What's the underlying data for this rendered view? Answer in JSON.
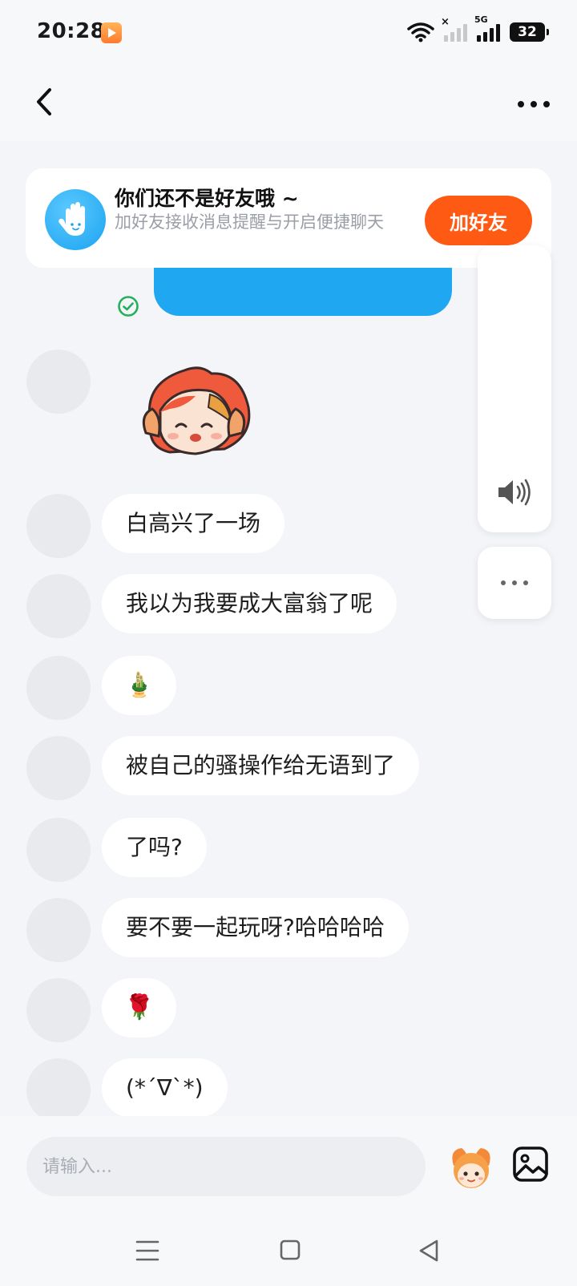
{
  "status_bar": {
    "time": "20:28",
    "network_label": "5G",
    "battery_level": "32",
    "icons": [
      "app-badge-icon",
      "wifi-icon",
      "signal-no-sim-icon",
      "signal-5g-icon",
      "battery-icon"
    ]
  },
  "header": {
    "back_icon": "chevron-left-icon",
    "more_icon": "more-horizontal-icon"
  },
  "friend_banner": {
    "icon": "waving-hand-icon",
    "title": "你们还不是好友哦 ~",
    "subtitle": "加好友接收消息提醒与开启便捷聊天",
    "button_label": "加好友",
    "button_color": "#ff5a14"
  },
  "messages": [
    {
      "type": "sticker",
      "content": "cartoon-character-sticker"
    },
    {
      "type": "text",
      "content": "白高兴了一场"
    },
    {
      "type": "text",
      "content": "我以为我要成大富翁了呢"
    },
    {
      "type": "emoji",
      "content": "🎍"
    },
    {
      "type": "text",
      "content": "被自己的骚操作给无语到了"
    },
    {
      "type": "text",
      "content": "了吗?"
    },
    {
      "type": "text",
      "content": "要不要一起玩呀?哈哈哈哈"
    },
    {
      "type": "emoji",
      "content": "🌹"
    },
    {
      "type": "text",
      "content": "(*´∇`*)"
    }
  ],
  "floating_panel": {
    "volume_icon": "speaker-volume-icon",
    "more_icon": "more-horizontal-icon"
  },
  "composer": {
    "placeholder": "请输入...",
    "sticker_icon": "mascot-sticker-icon",
    "image_icon": "image-icon"
  },
  "system_nav": [
    "menu-icon",
    "home-square-icon",
    "back-triangle-icon"
  ],
  "colors": {
    "accent_blue": "#1fa7f2",
    "accent_orange": "#ff5a14",
    "background": "#f3f5f9",
    "bubble": "#ffffff",
    "avatar_placeholder": "#e8eaee"
  }
}
